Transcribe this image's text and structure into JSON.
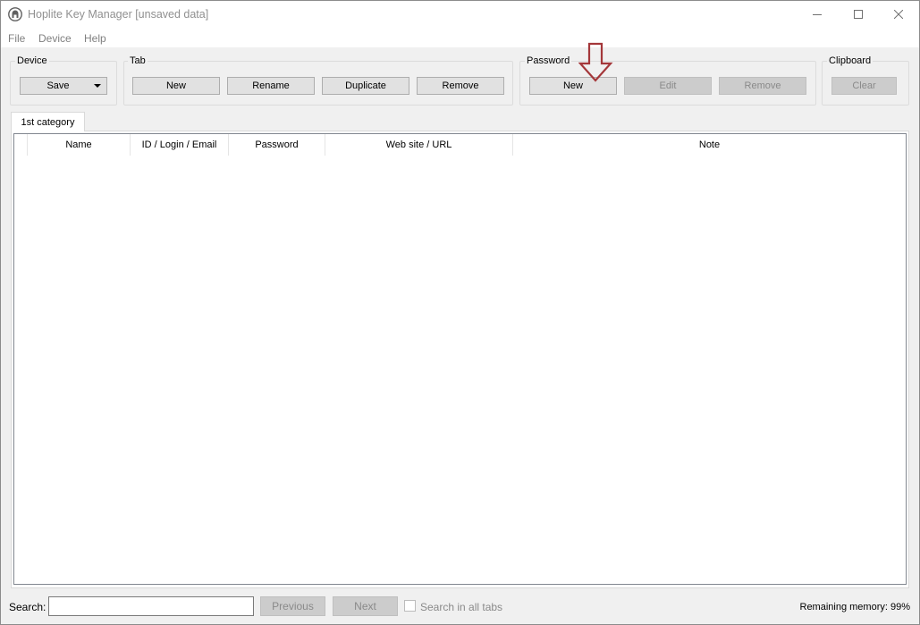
{
  "window": {
    "title": "Hoplite Key Manager [unsaved data]",
    "controls": {
      "minimize": "—",
      "maximize": "☐",
      "close": "✕"
    }
  },
  "menu": [
    "File",
    "Device",
    "Help"
  ],
  "groups": {
    "device": {
      "label": "Device",
      "save": "Save"
    },
    "tab": {
      "label": "Tab",
      "new": "New",
      "rename": "Rename",
      "duplicate": "Duplicate",
      "remove": "Remove"
    },
    "password": {
      "label": "Password",
      "new": "New",
      "edit": "Edit",
      "remove": "Remove"
    },
    "clipboard": {
      "label": "Clipboard",
      "clear": "Clear"
    }
  },
  "tabs": [
    "1st category"
  ],
  "table": {
    "columns": [
      "Name",
      "ID / Login / Email",
      "Password",
      "Web site / URL",
      "Note"
    ],
    "rows": []
  },
  "footer": {
    "search_label": "Search:",
    "search_value": "",
    "previous": "Previous",
    "next": "Next",
    "search_all_tabs": "Search in all tabs",
    "remaining_memory": "Remaining memory: 99%"
  },
  "colors": {
    "arrow": "#a4373a",
    "disabled_button": "#cccccc"
  },
  "icons": {
    "app": "helmet-icon",
    "dropdown": "caret-down-icon",
    "annotation": "down-arrow-icon"
  }
}
